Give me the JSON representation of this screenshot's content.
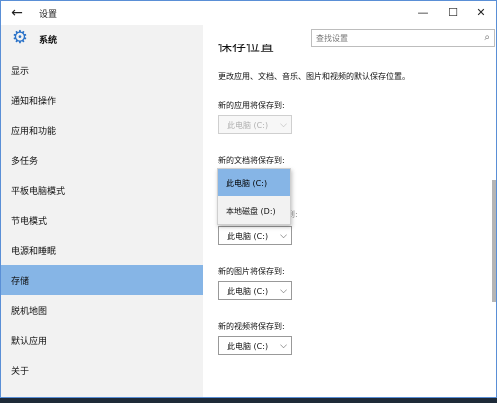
{
  "window": {
    "title": "设置",
    "back_glyph": "←",
    "minimize_glyph": "—",
    "maximize_glyph": "☐",
    "close_glyph": "✕"
  },
  "sidebar": {
    "section_title": "系统",
    "gear_glyph": "⚙",
    "items": [
      {
        "label": "显示"
      },
      {
        "label": "通知和操作"
      },
      {
        "label": "应用和功能"
      },
      {
        "label": "多任务"
      },
      {
        "label": "平板电脑模式"
      },
      {
        "label": "节电模式"
      },
      {
        "label": "电源和睡眠"
      },
      {
        "label": "存储",
        "active": true
      },
      {
        "label": "脱机地图"
      },
      {
        "label": "默认应用"
      },
      {
        "label": "关于"
      }
    ]
  },
  "search": {
    "placeholder": "查找设置",
    "icon_glyph": "⌕"
  },
  "content": {
    "heading": "保存位置",
    "description": "更改应用、文档、音乐、图片和视频的默认保存位置。",
    "chevron": "⌵",
    "apps": {
      "label": "新的应用将保存到:",
      "value": "此电脑 (C:)",
      "disabled": true
    },
    "docs": {
      "label": "新的文档将保存到:",
      "options": [
        "此电脑 (C:)",
        "本地磁盘 (D:)"
      ],
      "selected": "此电脑 (C:)"
    },
    "music": {
      "partial_label": "到:",
      "value": "此电脑 (C:)"
    },
    "pictures": {
      "label": "新的图片将保存到:",
      "value": "此电脑 (C:)"
    },
    "videos": {
      "label": "新的视频将保存到:",
      "value": "此电脑 (C:)"
    }
  },
  "colors": {
    "accent": "#2a72c8",
    "selection": "#86b5e6",
    "sidebar_bg": "#f2f2f2"
  }
}
